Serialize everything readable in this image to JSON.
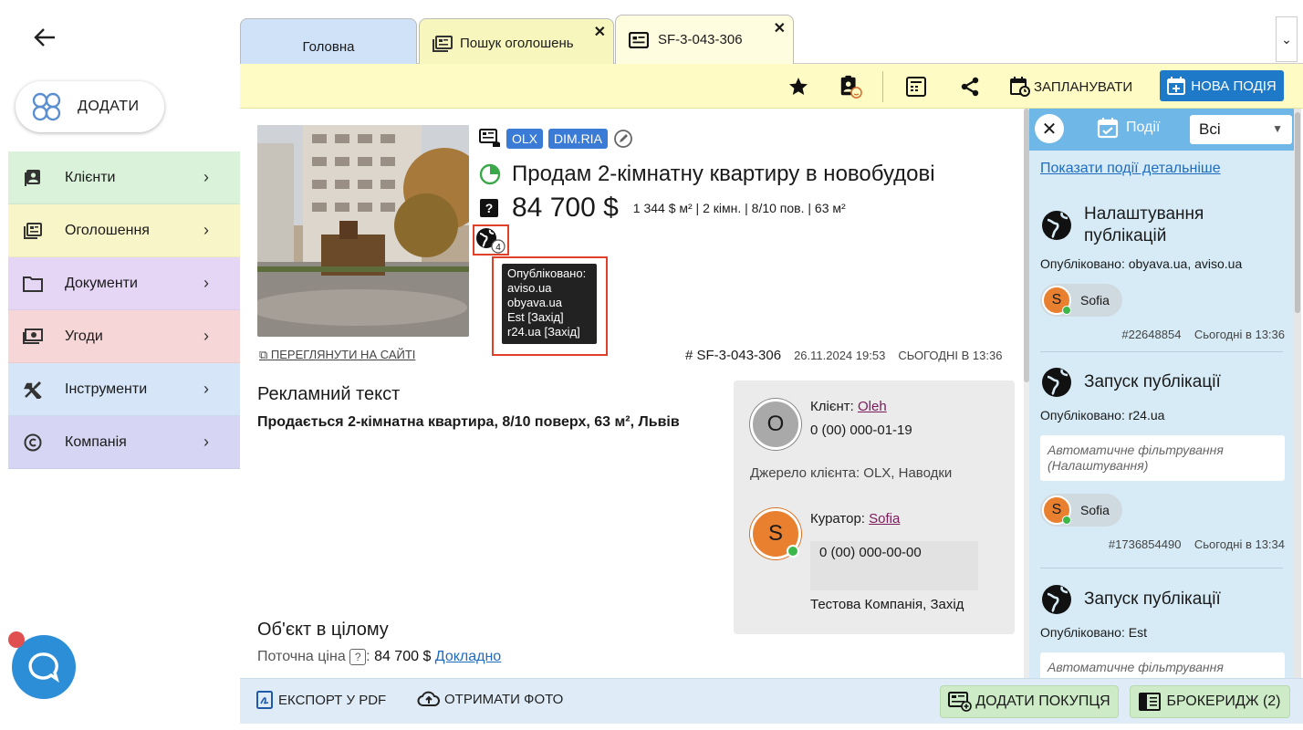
{
  "tabs": [
    {
      "label": "Головна"
    },
    {
      "label": "Пошук оголошень"
    },
    {
      "label": "SF-3-043-306"
    }
  ],
  "sidebar": {
    "add_label": "ДОДАТИ",
    "items": [
      {
        "label": "Клієнти",
        "color": "#d9f2d9"
      },
      {
        "label": "Оголошення",
        "color": "#f8f6c8"
      },
      {
        "label": "Документи",
        "color": "#e6d6f6"
      },
      {
        "label": "Угоди",
        "color": "#f6d6d6"
      },
      {
        "label": "Інструменти",
        "color": "#d6e6f8"
      },
      {
        "label": "Компанія",
        "color": "#d6d6f4"
      }
    ]
  },
  "toolbar": {
    "schedule_label": "ЗАПЛАНУВАТИ",
    "new_event_label": "НОВА ПОДІЯ"
  },
  "listing": {
    "badges": [
      "OLX",
      "DIM.RIA"
    ],
    "title": "Продам 2-кімнатну квартиру в новобудові",
    "price": "84 700 $",
    "meta": "1 344 $ м² | 2 кімн. | 8/10 пов. | 63 м²",
    "published_count": "4",
    "view_site": "ПЕРЕГЛЯНУТИ НА САЙТІ",
    "ref": "# SF-3-043-306",
    "created": "26.11.2024 19:53",
    "updated": "СЬОГОДНІ В 13:36",
    "tooltip": {
      "header": "Опубліковано:",
      "sites": [
        "aviso.ua",
        "obyava.ua",
        "Est [Захід]",
        "r24.ua [Захід]"
      ]
    }
  },
  "ad_text": {
    "heading": "Рекламний текст",
    "body": "Продається 2-кімнатна квартира, 8/10 поверх, 63 м², Львів"
  },
  "object": {
    "heading": "Об'єкт в цілому",
    "price_label": "Поточна ціна",
    "price_value": "84 700 $",
    "details_link": "Докладно"
  },
  "client_card": {
    "client_label": "Клієнт:",
    "client_name": "Oleh",
    "client_initial": "O",
    "client_phone": "0 (00) 000-01-19",
    "source": "Джерело клієнта: OLX, Наводки",
    "curator_label": "Куратор:",
    "curator_name": "Sofia",
    "curator_initial": "S",
    "curator_phone": "0 (00) 000-00-00",
    "company": "Тестова Компанія, Захід"
  },
  "bottom": {
    "export_pdf": "ЕКСПОРТ У PDF",
    "get_photo": "ОТРИМАТИ ФОТО",
    "add_buyer": "ДОДАТИ ПОКУПЦЯ",
    "brokerage": "БРОКЕРИДЖ (2)"
  },
  "events_panel": {
    "tab_label": "Події",
    "filter_value": "Всі",
    "details_link": "Показати події детальніше",
    "events": [
      {
        "title": "Налаштування публікацій",
        "published": "Опубліковано: obyava.ua, aviso.ua",
        "note": "",
        "user": "Sofia",
        "user_initial": "S",
        "id": "#22648854",
        "time": "Сьогодні в 13:36"
      },
      {
        "title": "Запуск публікації",
        "published": "Опубліковано: r24.ua",
        "note": "Автоматичне фільтрування (Налаштування)",
        "user": "Sofia",
        "user_initial": "S",
        "id": "#1736854490",
        "time": "Сьогодні в 13:34"
      },
      {
        "title": "Запуск публікації",
        "published": "Опубліковано: Est",
        "note": "Автоматичне фільтрування",
        "user": "",
        "user_initial": "",
        "id": "",
        "time": ""
      }
    ]
  }
}
